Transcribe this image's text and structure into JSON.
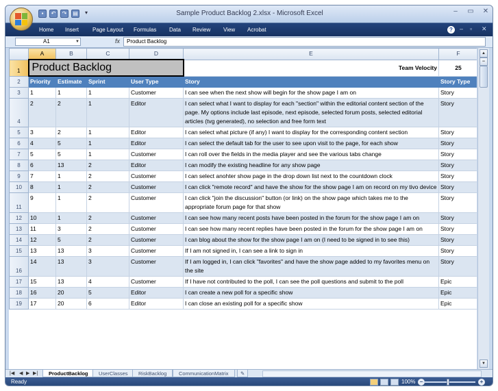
{
  "window": {
    "title": "Sample Product Backlog 2.xlsx - Microsoft Excel"
  },
  "ribbon_tabs": [
    "Home",
    "Insert",
    "Page Layout",
    "Formulas",
    "Data",
    "Review",
    "View",
    "Acrobat"
  ],
  "formula_bar": {
    "cell_ref": "A1",
    "fx": "fx",
    "content": "Product Backlog"
  },
  "columns": [
    "A",
    "B",
    "C",
    "D",
    "E",
    "F"
  ],
  "sheet": {
    "title": "Product Backlog",
    "team_velocity_label": "Team Velocity",
    "team_velocity": "25",
    "headers": [
      "Priority",
      "Estimate",
      "Sprint",
      "User Type",
      "Story",
      "Story Type"
    ],
    "rows": [
      {
        "row": "3",
        "cells": [
          "1",
          "1",
          "1",
          "Customer",
          "I can see when the next show will begin for the show page I am on",
          "Story"
        ]
      },
      {
        "row": "4",
        "cells": [
          "2",
          "2",
          "1",
          "Editor",
          "I can select what I want to display for each \"section\" within the editorial content section of the page.  My options include last episode, next episode, selected forum posts, selected editorial articles (tvg generated), no selection and free form text",
          "Story"
        ]
      },
      {
        "row": "5",
        "cells": [
          "3",
          "2",
          "1",
          "Editor",
          "I can select what picture (if any) I want to display for the corresponding content section",
          "Story"
        ]
      },
      {
        "row": "6",
        "cells": [
          "4",
          "5",
          "1",
          "Editor",
          "I can select the default tab for the user to see upon visit to the page, for each show",
          "Story"
        ]
      },
      {
        "row": "7",
        "cells": [
          "5",
          "5",
          "1",
          "Customer",
          "I can roll over the fields in the media player and see the various tabs change",
          "Story"
        ]
      },
      {
        "row": "8",
        "cells": [
          "6",
          "13",
          "2",
          "Editor",
          "I can modify the existing headline for any show page",
          "Story"
        ]
      },
      {
        "row": "9",
        "cells": [
          "7",
          "1",
          "2",
          "Customer",
          "I can select anohter show page in the drop down list next to the countdown clock",
          "Story"
        ]
      },
      {
        "row": "10",
        "cells": [
          "8",
          "1",
          "2",
          "Customer",
          "I can click \"remote record\" and have the show for the show page I am on record on my tivo device",
          "Story"
        ]
      },
      {
        "row": "11",
        "cells": [
          "9",
          "1",
          "2",
          "Customer",
          "I can click \"join the discussion\" button (or link) on the show page which takes me to the appropriate forum page for that show",
          "Story"
        ]
      },
      {
        "row": "12",
        "cells": [
          "10",
          "1",
          "2",
          "Customer",
          "I can see how many recent posts have been posted in the forum for the show page I am on",
          "Story"
        ]
      },
      {
        "row": "13",
        "cells": [
          "11",
          "3",
          "2",
          "Customer",
          "I can see how many recent replies have been posted in the forum for the show page I am on",
          "Story"
        ]
      },
      {
        "row": "14",
        "cells": [
          "12",
          "5",
          "2",
          "Customer",
          "I can blog about the show for the show page I am on (I need to be signed in to see this)",
          "Story"
        ]
      },
      {
        "row": "15",
        "cells": [
          "13",
          "13",
          "3",
          "Customer",
          "If I am not signed in, I can see a link to sign in",
          "Story"
        ]
      },
      {
        "row": "16",
        "cells": [
          "14",
          "13",
          "3",
          "Customer",
          "If I am logged in, I can click \"favorites\" and have the show page added to my favorites menu on the site",
          "Story"
        ]
      },
      {
        "row": "17",
        "cells": [
          "15",
          "13",
          "4",
          "Customer",
          "If I have not contributed to the poll, I can see the poll questions and submit to the poll",
          "Epic"
        ]
      },
      {
        "row": "18",
        "cells": [
          "16",
          "20",
          "5",
          "Editor",
          "I can create a new poll for a specific show",
          "Epic"
        ]
      },
      {
        "row": "19",
        "cells": [
          "17",
          "20",
          "6",
          "Editor",
          "I can close an existing poll for a specific show",
          "Epic"
        ]
      }
    ]
  },
  "sheet_tabs": [
    "ProductBacklog",
    "UserClasses",
    "RiskBacklog",
    "CommunicationMatrix"
  ],
  "status": {
    "text": "Ready",
    "zoom": "100%"
  }
}
